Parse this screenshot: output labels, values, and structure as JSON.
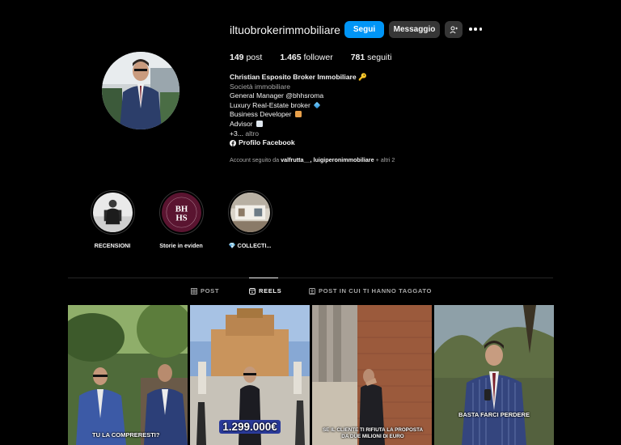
{
  "header": {
    "username": "iltuobrokerimmobiliare",
    "follow_label": "Segui",
    "message_label": "Messaggio",
    "add_user_icon": "add-user-icon",
    "more_icon": "more-options-icon"
  },
  "stats": {
    "posts_count": "149",
    "posts_label": "post",
    "followers_count": "1.465",
    "followers_label": "follower",
    "following_count": "781",
    "following_label": "seguiti"
  },
  "bio": {
    "name": "Christian Esposito Broker Immobiliare",
    "name_emoji": "🔑",
    "category": "Società immobiliare",
    "lines": [
      "General Manager @bhhsroma",
      "Luxury Real-Estate broker",
      "Business Developer",
      "Advisor",
      "+3..."
    ],
    "more_label": "altro",
    "facebook_label": "Profilo Facebook"
  },
  "followed_by": {
    "prefix": "Account seguito da",
    "users": "valfrutta__, luigiperonimmobiliare",
    "suffix": "+ altri 2"
  },
  "highlights": [
    {
      "label": "RECENSIONI"
    },
    {
      "label": "Storie in eviden"
    },
    {
      "label": "💎 COLLECTI..."
    }
  ],
  "tabs": {
    "post": "POST",
    "reels": "REELS",
    "tagged": "POST IN CUI TI HANNO TAGGATO",
    "active": "REELS"
  },
  "reels": [
    {
      "caption": "TU LA COMPRERESTI?"
    },
    {
      "caption": "1.299.000€"
    },
    {
      "caption": "SE IL CLIENTE TI RIFIUTA LA PROPOSTA DA DUE MILIONI DI EURO"
    },
    {
      "caption": "BASTA FARCI PERDERE"
    }
  ],
  "colors": {
    "background": "#000000",
    "follow_button": "#0095f6",
    "secondary_button": "#363636",
    "muted_text": "#a8a8a8"
  }
}
